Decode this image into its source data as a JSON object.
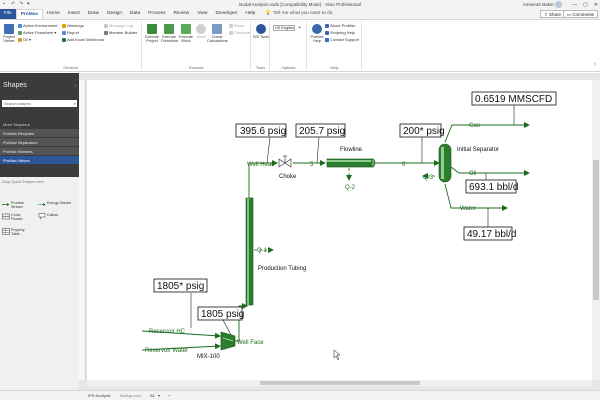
{
  "window": {
    "title": "Nodal Analysis.vsdx  [Compatibility Mode]  -  Visio Professional",
    "user": "Ameerah Baker",
    "qat_icons": [
      "save-icon",
      "undo-icon",
      "redo-icon",
      "customize-icon"
    ]
  },
  "tabs": [
    "File",
    "ProMax",
    "Home",
    "Insert",
    "Draw",
    "Design",
    "Data",
    "Process",
    "Review",
    "View",
    "Developer",
    "Help"
  ],
  "active_tab": "ProMax",
  "tell_me": "Tell me what you want to do",
  "share_label": "Share",
  "comments_label": "Comments",
  "ribbon": {
    "general": {
      "label": "General",
      "project_viewer": "Project Viewer",
      "active_environment": "Active Environment",
      "active_flowsheet": "Active Flowsheet",
      "oil": "Oil",
      "warnings": "Warnings",
      "report": "Report",
      "add_excel_workbook": "Add Excel Workbook",
      "message_log": "Message Log",
      "member_builder": "Member Builder"
    },
    "execute": {
      "label": "Execute",
      "execute_project": "Execute Project",
      "execute_flowsheet": "Execute Flowsheet",
      "execute_block": "Execute Block",
      "abort": "Abort",
      "check_calculations": "Check Calculations",
      "reset": "Reset",
      "continue": "Continue"
    },
    "tools": {
      "label": "Tools",
      "sis_tools": "SIS Tools"
    },
    "options": {
      "label": "Options",
      "unit_set": "US English"
    },
    "help": {
      "label": "Help",
      "promax_help": "ProMax Help",
      "about": "About ProMax",
      "scripting_help": "Scripting Help",
      "contact_support": "Contact Support"
    }
  },
  "shapes_pane": {
    "title": "Shapes",
    "search_placeholder": "Search shapes",
    "more_shapes": "More Shapes",
    "stencils": [
      {
        "label": "ProMax Recycles",
        "active": false
      },
      {
        "label": "ProMax Separators",
        "active": false
      },
      {
        "label": "ProMax Streams",
        "active": false
      },
      {
        "label": "ProMax Valves",
        "active": true
      }
    ],
    "drop_hint": "Drop Quick Shapes here",
    "masters": [
      "Process Stream",
      "Energy Stream",
      "Cross Flowsh...",
      "Callout",
      "Property Table"
    ]
  },
  "diagram": {
    "callouts": {
      "gas_rate": "0.6519 MMSCFD",
      "wellhead_p": "395.6 psig",
      "flowline_p": "205.7 psig",
      "separator_p": "200* psig",
      "oil_rate": "693.1 bbl/d",
      "water_rate": "49.17 bbl/d",
      "reservoir_p": "1805* psig",
      "wellface_p": "1805 psig"
    },
    "labels": {
      "gas": "Gas",
      "oil": "Oil",
      "water": "Water",
      "well_head": "Well Head",
      "choke": "Choke",
      "s5": "5",
      "s6": "6",
      "flowline": "Flowline",
      "q2": "Q-2",
      "q3": "Q-3",
      "q1": "Q-1",
      "initial_separator": "Initial Separator",
      "production_tubing": "Production Tubing",
      "reservoir_hc": "Reservoir HC",
      "reservoir_water": "Reservoir Water",
      "well_face": "Well Face",
      "mix100": "MIX-100"
    }
  },
  "statusbar": {
    "page_tabs": [
      "IPR Analysis",
      "Background",
      "All"
    ],
    "add_page": "+"
  },
  "colors": {
    "accent": "#2b579a",
    "stream": "#1e6b1e",
    "panel": "#3b3b3b"
  }
}
